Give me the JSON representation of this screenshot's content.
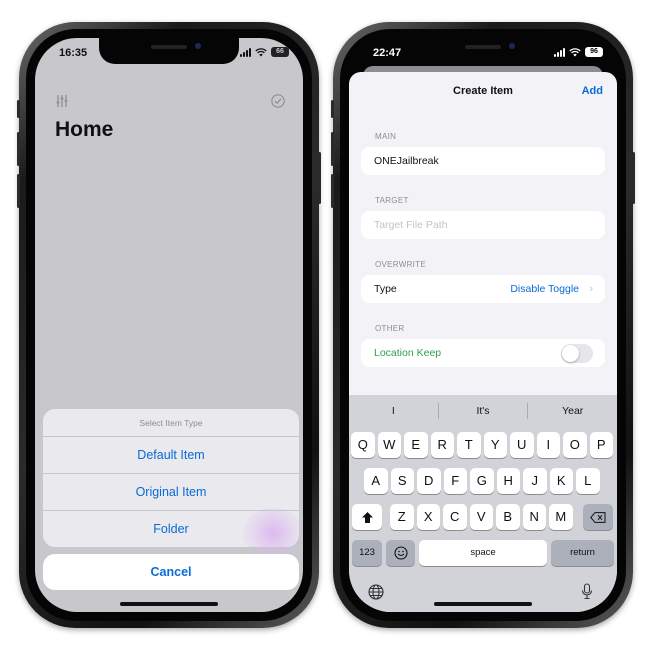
{
  "left_phone": {
    "status_time": "16:35",
    "battery": "66",
    "home_title": "Home",
    "action_sheet": {
      "title": "Select Item Type",
      "items": [
        "Default Item",
        "Original Item",
        "Folder"
      ],
      "cancel": "Cancel"
    }
  },
  "right_phone": {
    "status_time": "22:47",
    "battery": "96",
    "nav": {
      "title": "Create Item",
      "add": "Add"
    },
    "sections": {
      "main": {
        "label": "MAIN",
        "value": "ONEJailbreak"
      },
      "target": {
        "label": "TARGET",
        "placeholder": "Target File Path"
      },
      "overwrite": {
        "label": "OVERWRITE",
        "row_label": "Type",
        "row_value": "Disable Toggle"
      },
      "other": {
        "label": "OTHER",
        "row_label": "Location Keep",
        "toggle_on": false
      }
    },
    "keyboard": {
      "suggestions": [
        "I",
        "It's",
        "Year"
      ],
      "row1": [
        "Q",
        "W",
        "E",
        "R",
        "T",
        "Y",
        "U",
        "I",
        "O",
        "P"
      ],
      "row2": [
        "A",
        "S",
        "D",
        "F",
        "G",
        "H",
        "J",
        "K",
        "L"
      ],
      "row3": [
        "Z",
        "X",
        "C",
        "V",
        "B",
        "N",
        "M"
      ],
      "numbers_key": "123",
      "space_key": "space",
      "return_key": "return"
    }
  },
  "colors": {
    "accent": "#0a6ad8",
    "green": "#30a14e"
  }
}
